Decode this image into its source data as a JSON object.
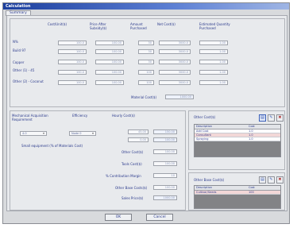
{
  "window": {
    "title": "Calculation"
  },
  "tabs": [
    {
      "label": "Summary"
    }
  ],
  "summary": {
    "headers": {
      "cost": "Cost/Unit($)",
      "price_after": "Price After Subsidy($)",
      "amount": "Amount Purchased",
      "net_cost": "Net Cost($)",
      "estimated": "Estimated Quantity Purchased"
    },
    "rows": [
      {
        "label": "N%",
        "cost": "100.0",
        "price": "100.00",
        "amount": "30",
        "net": "3000.0",
        "est": "1.00"
      },
      {
        "label": "Build 97",
        "cost": "100.0",
        "price": "100.00",
        "amount": "30",
        "net": "3000.0",
        "est": "1.00"
      },
      {
        "label": "Copper",
        "cost": "100.0",
        "price": "100.00",
        "amount": "30",
        "net": "3000.0",
        "est": "1.00"
      },
      {
        "label": "Other (1) - 45",
        "cost": "100.0",
        "price": "100.00",
        "amount": "100",
        "net": "3000.0",
        "est": "1.00"
      },
      {
        "label": "Other (2) - Coconut",
        "cost": "100.0",
        "price": "100.00",
        "amount": "100",
        "net": "3000.0",
        "est": "1.00"
      }
    ],
    "material_cost_label": "Material Cost($)",
    "material_cost_value": "1000.00"
  },
  "calc": {
    "headers": {
      "machine": "Mechanical Acquisition Requirement",
      "efficiency": "Efficiency",
      "hourly": "Hourly Cost($)"
    },
    "machine_select": "4.0",
    "efficiency_select": "Node 0",
    "hourly_values": [
      "45.00",
      "0.00"
    ],
    "hourly_results": [
      "150.00",
      "100.00"
    ],
    "small_equipment_label": "Small equipment (% of Materials Cost)",
    "fields": [
      {
        "label": "Other Cost($)",
        "value": "100.00"
      },
      {
        "label": "Tools Cost($)",
        "value": "100.00"
      },
      {
        "label": "% Contribution Margin",
        "value": "10"
      },
      {
        "label": "Other Base Costs($)",
        "value": "100.00"
      },
      {
        "label": "Sales Price($)",
        "value": "1000.00"
      }
    ]
  },
  "other_costs": {
    "title": "Other Cost($)",
    "columns": [
      "Description",
      "Cost"
    ],
    "rows": [
      {
        "desc": "Add Cost",
        "cost": "1.0"
      },
      {
        "desc": "Consultant",
        "cost": "1.0"
      },
      {
        "desc": "Spraying",
        "cost": "1.0"
      }
    ]
  },
  "other_base": {
    "title": "Other Base Cost($)",
    "columns": [
      "Description",
      "Cost"
    ],
    "rows": [
      {
        "desc": "Cultivar/Seeds",
        "cost": "100"
      }
    ]
  },
  "buttons": {
    "ok": "OK",
    "cancel": "Cancel"
  },
  "colors": {
    "title_start": "#1c3f9e",
    "title_end": "#9fb5e4",
    "selected_row": "#f2d7d7",
    "text": "#2b3a8c"
  }
}
